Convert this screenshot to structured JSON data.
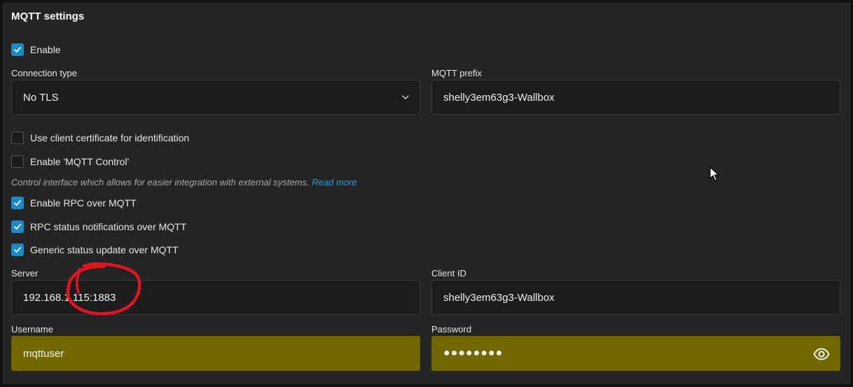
{
  "panel": {
    "title": "MQTT settings"
  },
  "enable": {
    "label": "Enable",
    "checked": true
  },
  "connection_type": {
    "label": "Connection type",
    "value": "No TLS"
  },
  "mqtt_prefix": {
    "label": "MQTT prefix",
    "value": "shelly3em63g3-Wallbox"
  },
  "client_cert": {
    "label": "Use client certificate for identification",
    "checked": false
  },
  "mqtt_control": {
    "label": "Enable 'MQTT Control'",
    "checked": false,
    "hint": "Control interface which allows for easier integration with external systems.",
    "read_more": "Read more"
  },
  "rpc_over_mqtt": {
    "label": "Enable RPC over MQTT",
    "checked": true
  },
  "rpc_status": {
    "label": "RPC status notifications over MQTT",
    "checked": true
  },
  "generic_status": {
    "label": "Generic status update over MQTT",
    "checked": true
  },
  "server": {
    "label": "Server",
    "value": "192.168.1.115:1883"
  },
  "client_id": {
    "label": "Client ID",
    "value": "shelly3em63g3-Wallbox"
  },
  "username": {
    "label": "Username",
    "value": "mqttuser"
  },
  "password": {
    "label": "Password",
    "value": "●●●●●●●●"
  },
  "colors": {
    "accent": "#1c8ac8",
    "autofill": "#716900",
    "panel_bg": "#242424",
    "annotation": "#e0141e"
  },
  "icons": [
    "check-icon",
    "chevron-down-icon",
    "eye-icon",
    "mouse-cursor-icon"
  ]
}
